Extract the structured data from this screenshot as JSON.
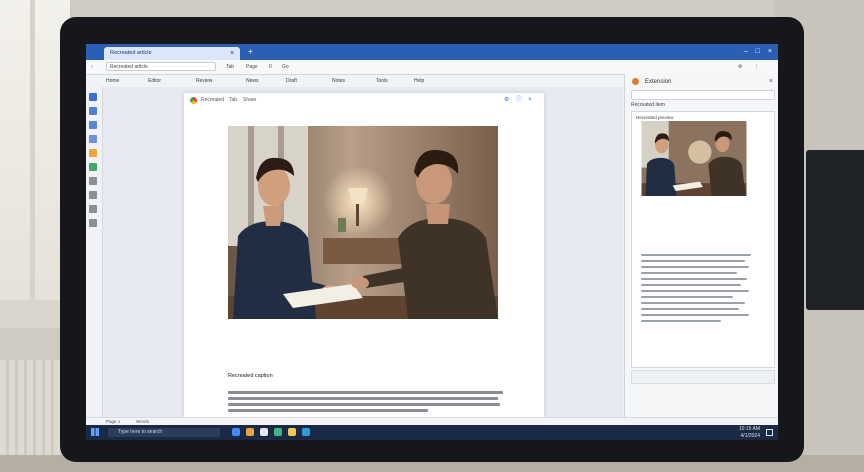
{
  "browser": {
    "tab_title": "Recreated article",
    "new_tab": "+",
    "window_controls": [
      "–",
      "□",
      "×"
    ],
    "url": "Recreated article",
    "toolbar_items": [
      "Recreated article",
      "Tab",
      "Page",
      "0",
      "Go"
    ]
  },
  "bookmarks": [
    "Home",
    "Editor",
    "Review",
    "News",
    "Draft",
    "Notes",
    "Tools",
    "Help"
  ],
  "document": {
    "header_tags": [
      "Recreated",
      "Tab",
      "Share"
    ],
    "caption": "Recreated caption"
  },
  "sidebar": {
    "title": "Extension",
    "close": "×",
    "row_label": "Recreated item",
    "card_title": "Recreated preview"
  },
  "statusbar": {
    "items": [
      "Page 1",
      "Words"
    ]
  },
  "taskbar": {
    "search_placeholder": "Type here to search",
    "clock_time": "10:15 AM",
    "clock_date": "4/1/2024"
  },
  "colors": {
    "titlebar": "#2b5fb5",
    "taskbar": "#1b2a44",
    "accent": "#3b6fd0"
  }
}
